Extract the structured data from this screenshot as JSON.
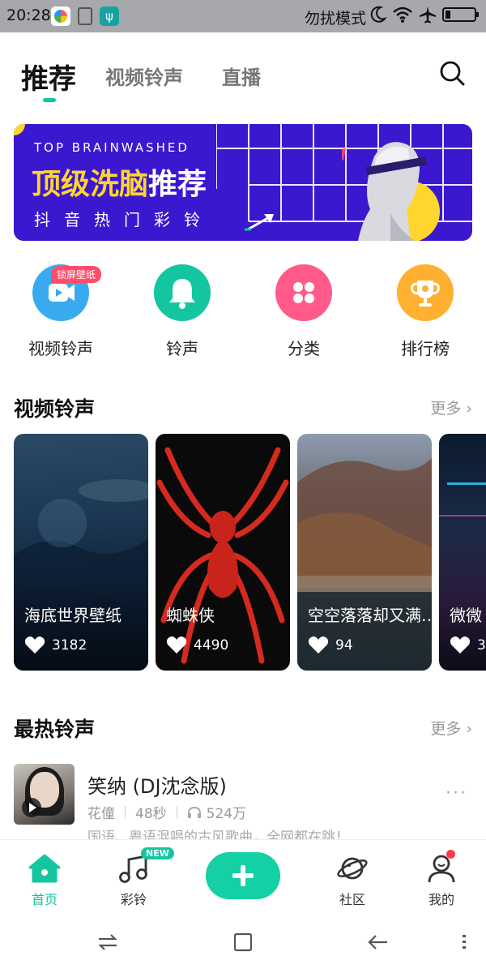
{
  "status_bar": {
    "time": "20:28",
    "usb_icon": "ψ",
    "mode_text": "勿扰模式"
  },
  "top_tabs": {
    "active": "推荐",
    "tab2": "视频铃声",
    "tab3": "直播"
  },
  "banner": {
    "en_text": "TOP BRAINWASHED",
    "title_part1": "顶级洗脑",
    "title_part2": "推荐",
    "subtitle": "抖音热门彩铃"
  },
  "quick_entries": [
    {
      "label": "视频铃声",
      "badge": "锁屏壁纸",
      "color": "#3aaaf0",
      "icon": "video-play-icon"
    },
    {
      "label": "铃声",
      "color": "#14c69f",
      "icon": "bell-icon"
    },
    {
      "label": "分类",
      "color": "#ff5a8a",
      "icon": "grid-icon"
    },
    {
      "label": "排行榜",
      "color": "#ffb030",
      "icon": "trophy-icon"
    }
  ],
  "video_section": {
    "title": "视频铃声",
    "more": "更多 ›",
    "cards": [
      {
        "title": "海底世界壁纸",
        "likes": "3182"
      },
      {
        "title": "蜘蛛侠",
        "likes": "4490"
      },
      {
        "title": "空空落落却又满…",
        "likes": "94"
      },
      {
        "title": "微微",
        "likes": "3"
      }
    ]
  },
  "hot_section": {
    "title": "最热铃声",
    "more": "更多 ›",
    "songs": [
      {
        "title": "笑纳 (DJ沈念版)",
        "artist": "花僮",
        "duration": "48秒",
        "plays": "524万",
        "desc": "国语、粤语混唱的古风歌曲，全网都在跳！",
        "more": "···"
      }
    ]
  },
  "bottom_nav": {
    "home": "首页",
    "ringtone": "彩铃",
    "new_badge": "NEW",
    "community": "社区",
    "mine": "我的"
  },
  "colors": {
    "accent": "#14c69f",
    "banner_bg": "#3b18cf",
    "banner_yellow": "#ffd52e"
  }
}
